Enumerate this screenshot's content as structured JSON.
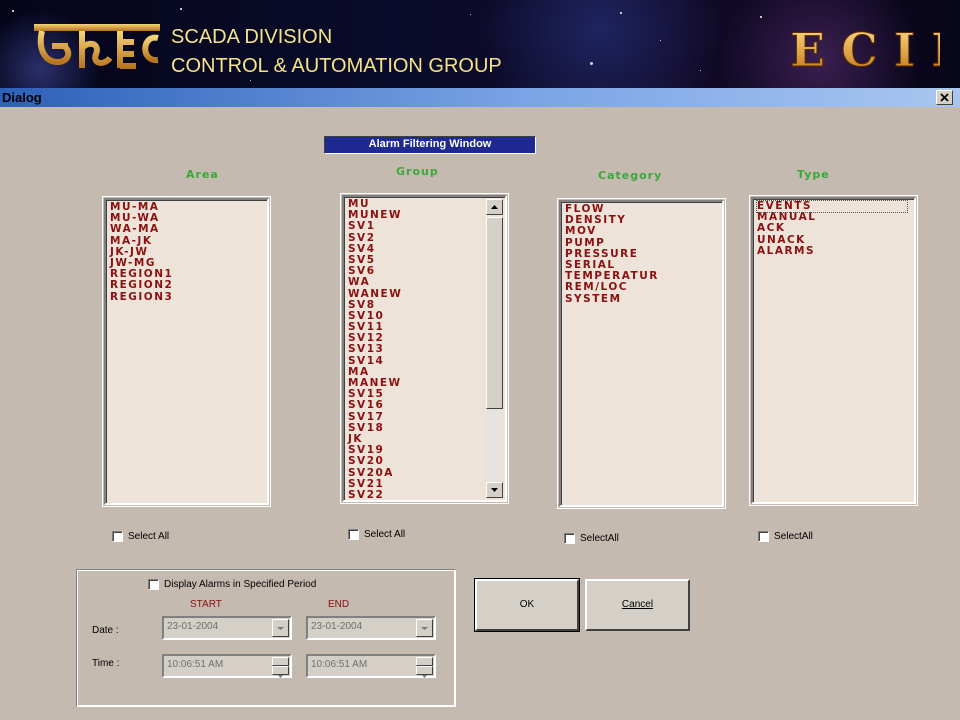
{
  "banner": {
    "logo_icon": "ecil-hindi-logo",
    "line1": "SCADA DIVISION",
    "line2": "CONTROL & AUTOMATION GROUP",
    "brand": "E C I L",
    "text_color": "#f4e38a",
    "brand_color": "#d9a521"
  },
  "dialog": {
    "title": "Dialog",
    "close_icon": "close-icon",
    "filter_window_title": "Alarm Filtering Window",
    "columns": {
      "area": {
        "header": "Area",
        "items": [
          "MU-MA",
          "MU-WA",
          "WA-MA",
          "MA-JK",
          "JK-JW",
          "JW-MG",
          "REGION1",
          "REGION2",
          "REGION3"
        ],
        "select_all": "Select All"
      },
      "group": {
        "header": "Group",
        "items": [
          "MU",
          "MUNEW",
          "SV1",
          "SV2",
          "SV4",
          "SV5",
          "SV6",
          "WA",
          "WANEW",
          "SV8",
          "SV10",
          "SV11",
          "SV12",
          "SV13",
          "SV14",
          "MA",
          "MANEW",
          "SV15",
          "SV16",
          "SV17",
          "SV18",
          "JK",
          "SV19",
          "SV20",
          "SV20A",
          "SV21",
          "SV22"
        ],
        "select_all": "Select All"
      },
      "category": {
        "header": "Category",
        "items": [
          "FLOW",
          "DENSITY",
          "MOV",
          "PUMP",
          "PRESSURE",
          "SERIAL",
          "TEMPERATUR",
          "REM/LOC",
          "SYSTEM"
        ],
        "select_all": "SelectAll"
      },
      "type": {
        "header": "Type",
        "items": [
          "EVENTS",
          "MANUAL",
          "ACK",
          "UNACK",
          "ALARMS"
        ],
        "select_all": "SelectAll"
      }
    },
    "period": {
      "checkbox_label": "Display Alarms in Specified Period",
      "start_label": "START",
      "end_label": "END",
      "date_label": "Date :",
      "time_label": "Time :",
      "start_date": "23-01-2004",
      "end_date": "23-01-2004",
      "start_time": "10:06:51 AM",
      "end_time": "10:06:51 AM"
    },
    "ok_label": "OK",
    "cancel_label": "Cancel"
  }
}
